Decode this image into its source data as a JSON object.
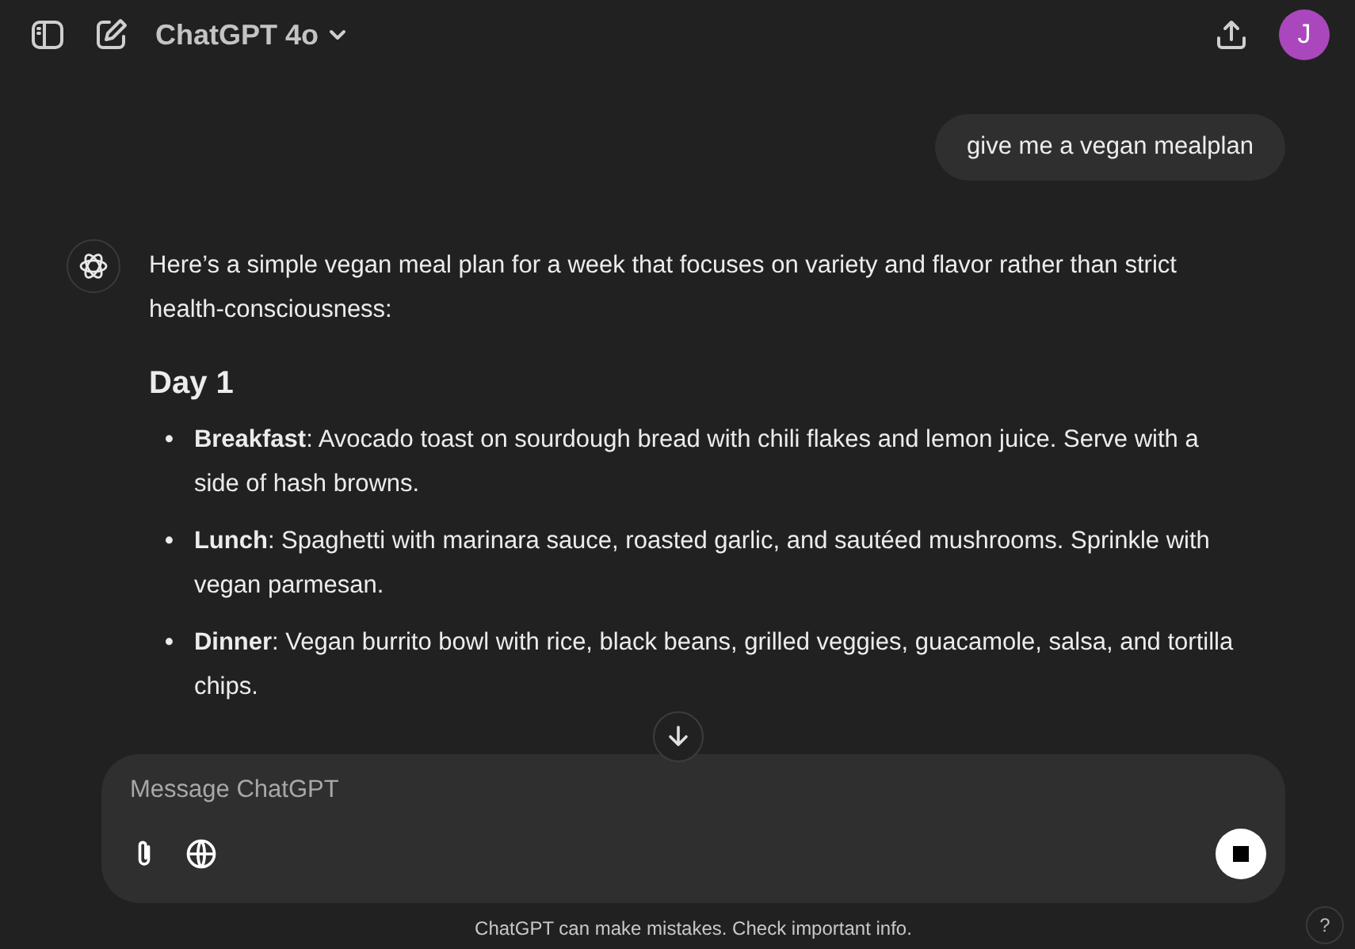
{
  "header": {
    "model": "ChatGPT 4o",
    "avatar": "J"
  },
  "messages": [
    {
      "kind": "user",
      "text": "give me a vegan mealplan"
    },
    {
      "kind": "assistant",
      "intro": "Here’s a simple vegan meal plan for a week that focuses on variety and flavor rather than strict health-consciousness:",
      "heading": "Day 1",
      "items": [
        {
          "marker": "•",
          "text": "**Breakfast**: Avocado toast on sourdough bread with chili flakes and lemon juice. Serve with a side of hash browns."
        },
        {
          "marker": "•",
          "text": "**Lunch**: Spaghetti with marinara sauce, roasted garlic, and sautéed mushrooms. Sprinkle with vegan parmesan."
        },
        {
          "marker": "•",
          "text": "**Dinner**: Vegan burrito bowl with rice, black beans, grilled veggies, guacamole, salsa, and tortilla chips."
        }
      ]
    }
  ],
  "composer": {
    "placeholder": "Message ChatGPT"
  },
  "disclaimer": "ChatGPT can make mistakes. Check important info.",
  "help": "?"
}
